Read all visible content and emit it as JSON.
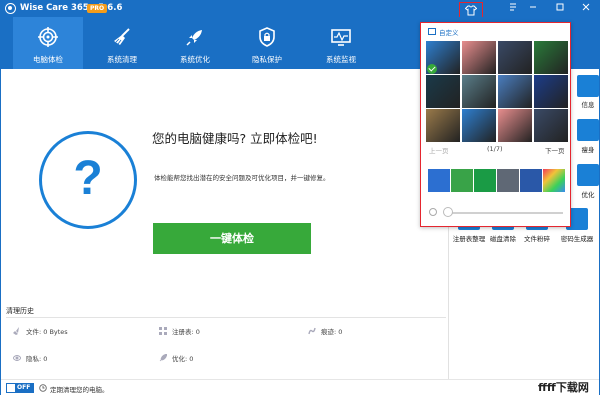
{
  "window": {
    "title": "Wise Care 365 - 5.6.6",
    "badge": "PRO",
    "controls": [
      "theme-icon",
      "menu-icon",
      "minimize-icon",
      "maximize-icon",
      "close-icon"
    ]
  },
  "nav": {
    "tabs": [
      {
        "label": "电脑体检",
        "icon": "target-icon",
        "active": true
      },
      {
        "label": "系统清理",
        "icon": "broom-icon",
        "active": false
      },
      {
        "label": "系统优化",
        "icon": "rocket-icon",
        "active": false
      },
      {
        "label": "隐私保护",
        "icon": "shield-icon",
        "active": false
      },
      {
        "label": "系统监视",
        "icon": "monitor-icon",
        "active": false
      }
    ]
  },
  "main": {
    "status_symbol": "?",
    "headline": "您的电脑健康吗? 立即体检吧!",
    "description": "体检能帮您找出潜在的安全问题及可优化项目，并一键修复。",
    "scan_button": "一键体检"
  },
  "history": {
    "title": "清理历史",
    "items": [
      {
        "label": "文件: 0 Bytes",
        "icon": "file-broom-icon"
      },
      {
        "label": "注册表: 0",
        "icon": "registry-icon"
      },
      {
        "label": "痕迹: 0",
        "icon": "trace-icon"
      },
      {
        "label": "隐私: 0",
        "icon": "eye-icon"
      },
      {
        "label": "优化: 0",
        "icon": "rocket-icon"
      }
    ]
  },
  "status_bar": {
    "toggle": "OFF",
    "text": "定期清理您的电脑。"
  },
  "side_panel": {
    "partial_labels": [
      "信息",
      "瘦身",
      "优化"
    ],
    "tools": [
      {
        "label": "注册表整理",
        "icon": "registry-tool-icon"
      },
      {
        "label": "磁盘清除",
        "icon": "disk-icon"
      },
      {
        "label": "文件粉碎",
        "icon": "shredder-icon"
      },
      {
        "label": "密码生成器",
        "icon": "key-icon"
      }
    ]
  },
  "theme_popup": {
    "title": "自定义",
    "prev": "上一页",
    "page": "(1/7)",
    "next": "下一页",
    "wallpapers": [
      "#2e7fd0",
      "#e88e8e",
      "#3a4a66",
      "#2a7b3a",
      "#1a3a4a",
      "#5a7e8a",
      "#4a7ec0",
      "#1c3d8a",
      "#9a7a4a"
    ],
    "swatches": [
      "#2c6fd1",
      "#39a348",
      "#1a9b45",
      "#5f6875",
      "#2a58a8",
      "#f17a2a"
    ],
    "colors": {
      "accent": "#1a6fc4",
      "scan": "#37a93a",
      "highlight": "#e5262f"
    }
  },
  "watermark": "ffff下载网"
}
